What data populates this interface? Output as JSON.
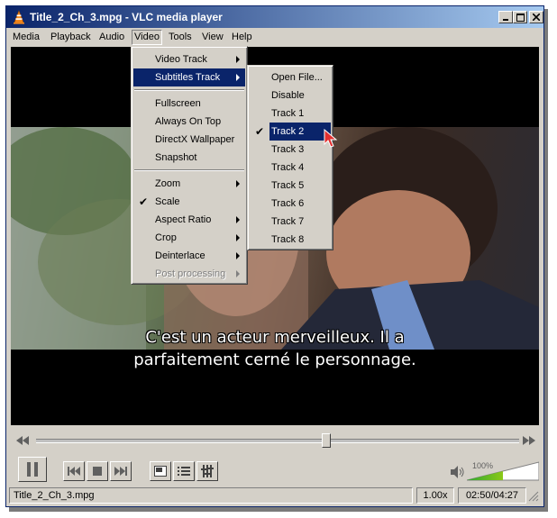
{
  "window": {
    "title": "Title_2_Ch_3.mpg - VLC media player",
    "app_icon": "vlc-cone-icon",
    "buttons": [
      "minimize-icon",
      "maximize-icon",
      "close-icon"
    ]
  },
  "menubar": {
    "items": [
      {
        "label": "Media"
      },
      {
        "label": "Playback"
      },
      {
        "label": "Audio"
      },
      {
        "label": "Video",
        "open": true
      },
      {
        "label": "Tools"
      },
      {
        "label": "View"
      },
      {
        "label": "Help"
      }
    ]
  },
  "video_menu": {
    "items": [
      {
        "label": "Video Track",
        "submenu": true
      },
      {
        "label": "Subtitles Track",
        "submenu": true,
        "highlighted": true
      },
      {
        "label": "Fullscreen"
      },
      {
        "label": "Always On Top"
      },
      {
        "label": "DirectX Wallpaper"
      },
      {
        "label": "Snapshot"
      },
      {
        "label": "Zoom",
        "submenu": true
      },
      {
        "label": "Scale",
        "checked": true
      },
      {
        "label": "Aspect Ratio",
        "submenu": true
      },
      {
        "label": "Crop",
        "submenu": true
      },
      {
        "label": "Deinterlace",
        "submenu": true
      },
      {
        "label": "Post processing",
        "submenu": true,
        "disabled": true
      }
    ]
  },
  "subtitles_menu": {
    "items": [
      {
        "label": "Open File..."
      },
      {
        "label": "Disable"
      },
      {
        "label": "Track 1"
      },
      {
        "label": "Track 2",
        "checked": true,
        "highlighted": true
      },
      {
        "label": "Track 3"
      },
      {
        "label": "Track 4"
      },
      {
        "label": "Track 5"
      },
      {
        "label": "Track 6"
      },
      {
        "label": "Track 7"
      },
      {
        "label": "Track 8"
      }
    ]
  },
  "video": {
    "subtitle_line1": "C'est un acteur merveilleux. Il a",
    "subtitle_line2": "parfaitement cerné le personnage."
  },
  "seek": {
    "position_fraction": 0.6,
    "rewind_icon": "rewind-icon",
    "forward_icon": "fast-forward-icon"
  },
  "controls": {
    "buttons": [
      "pause-icon",
      "previous-icon",
      "stop-icon",
      "next-icon",
      "fullscreen-icon",
      "playlist-icon",
      "extended-settings-icon"
    ],
    "volume_label": "100%",
    "volume_fraction": 0.5,
    "colors": {
      "volume_low": "#2fa82f",
      "volume_high": "#e8e800"
    }
  },
  "status": {
    "filename": "Title_2_Ch_3.mpg",
    "speed": "1.00x",
    "time": "02:50/04:27"
  }
}
